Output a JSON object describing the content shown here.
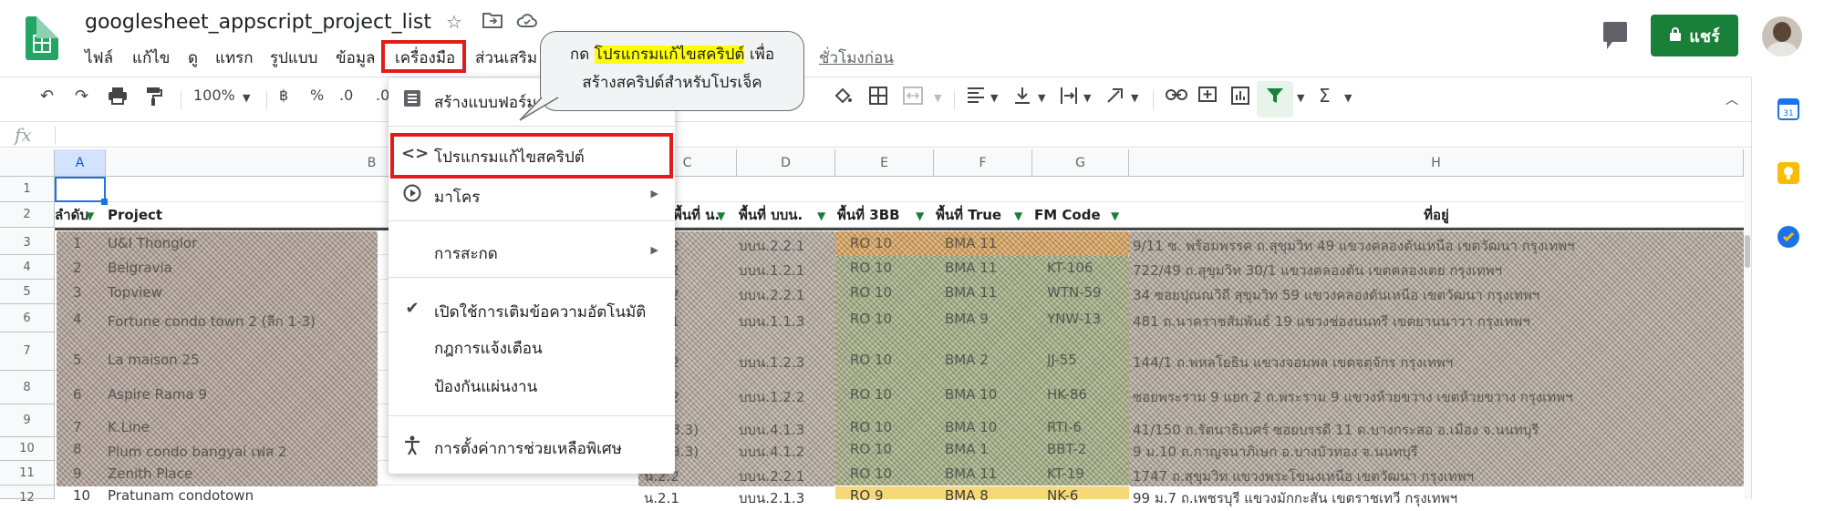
{
  "header": {
    "doc_title": "googlesheet_appscript_project_list",
    "last_edit": "ชั่วโมงก่อน",
    "share_label": "แชร์"
  },
  "menubar": {
    "items": [
      "ไฟล์",
      "แก้ไข",
      "ดู",
      "แทรก",
      "รูปแบบ",
      "ข้อมูล",
      "เครื่องมือ",
      "ส่วนเสริม"
    ]
  },
  "toolbar": {
    "zoom": "100%",
    "baht": "฿",
    "percent": "%",
    "decimal_less": ".0",
    "decimal_more": ".00"
  },
  "tools_menu": {
    "items": [
      {
        "label": "สร้างแบบฟอร์ม",
        "icon": "form-icon"
      },
      {
        "label": "โปรแกรมแก้ไขสคริปต์",
        "icon": "code-icon"
      },
      {
        "label": "มาโคร",
        "icon": "play-icon"
      },
      {
        "label": "การสะกด",
        "icon": ""
      },
      {
        "label": "เปิดใช้การเติมข้อความอัตโนมัติ",
        "icon": "check-icon"
      },
      {
        "label": "กฎการแจ้งเตือน",
        "icon": ""
      },
      {
        "label": "ป้องกันแผ่นงาน",
        "icon": ""
      },
      {
        "label": "การตั้งค่าการช่วยเหลือพิเศษ",
        "icon": "accessibility-icon"
      }
    ]
  },
  "tooltip": {
    "prefix": "กด",
    "highlight": "โปรแกรมแก้ไขสคริปต์",
    "suffix": "เพื่อ",
    "line2": "สร้างสคริปต์สำหรับโปรเจ็ค"
  },
  "grid": {
    "col_headers": [
      "A",
      "B",
      "C",
      "D",
      "E",
      "F",
      "G",
      "H"
    ],
    "row_numbers": [
      "1",
      "2",
      "3",
      "4",
      "5",
      "6",
      "7",
      "8",
      "9",
      "10",
      "11",
      "12"
    ],
    "header_row": {
      "a": "ลำดับ",
      "b": "Project",
      "c": "พื้นที่ น.",
      "d": "พื้นที่ บบน.",
      "e": "พื้นที่ 3BB",
      "f": "พื้นที่ True",
      "g": "FM Code",
      "h": "ที่อยู่"
    },
    "rows": [
      {
        "a": "1",
        "b": "U&I Thonglor",
        "c": "น.2.2",
        "d": "บบน.2.2.1",
        "e": "RO 10",
        "f": "BMA 11",
        "g": "",
        "h": "9/11 ซ. พร้อมพรรค ถ.สุขุมวิท 49 แขวงคลองตันเหนือ เขตวัฒนา กรุงเทพฯ"
      },
      {
        "a": "2",
        "b": "Belgravia",
        "c": "น.1.2",
        "d": "บบน.1.2.1",
        "e": "RO 10",
        "f": "BMA 11",
        "g": "KT-106",
        "h": "722/49 ถ.สุขุมวิท 30/1 แขวงคลองตัน เขตคลองเตย กรุงเทพฯ"
      },
      {
        "a": "3",
        "b": "Topview",
        "c": "น.2.2",
        "d": "บบน.2.2.1",
        "e": "RO 10",
        "f": "BMA 11",
        "g": "WTN-59",
        "h": "34 ซอยปุณณวิถี สุขุมวิท 59 แขวงคลองตันเหนือ เขตวัฒนา กรุงเทพฯ"
      },
      {
        "a": "4",
        "b": "Fortune condo town 2 (ลีก 1-3)",
        "c": "น.1.1",
        "d": "บบน.1.1.3",
        "e": "RO 10",
        "f": "BMA 9",
        "g": "YNW-13",
        "h": "481 ถ.นาคราชสัมพันธ์ 19 แขวงช่องนนทรี เขตยานนาวา กรุงเทพฯ"
      },
      {
        "a": "5",
        "b": "La maison 25",
        "c": "น.1.2",
        "d": "บบน.1.2.3",
        "e": "RO 10",
        "f": "BMA 2",
        "g": "JJ-55",
        "h": "144/1 ถ.พหลโยธิน แขวงจอมพล เขตจตุจักร กรุงเทพฯ"
      },
      {
        "a": "6",
        "b": "Aspire Rama 9",
        "c": "น.1.2",
        "d": "บบน.1.2.2",
        "e": "RO 10",
        "f": "BMA 10",
        "g": "HK-86",
        "h": "ซอยพระราม 9 แยก 2 ถ.พระราม 9 แขวงห้วยขวาง เขตห้วยขวาง กรุงเทพฯ"
      },
      {
        "a": "7",
        "b": "K.Line",
        "c": "น.1(3.3)",
        "d": "บบน.4.1.3",
        "e": "RO 10",
        "f": "BMA 10",
        "g": "RTI-6",
        "h": "41/150 ถ.รัตนาธิเบศร์ ซอยบรรดี 11 ต.บางกระสอ อ.เมือง จ.นนทบุรี"
      },
      {
        "a": "8",
        "b": "Plum condo bangyai เฟส 2",
        "c": "น.1(3.3)",
        "d": "บบน.4.1.2",
        "e": "RO 10",
        "f": "BMA 1",
        "g": "BBT-2",
        "h": "9 ม.10 ถ.กาญจนาภิเษก อ.บางบัวทอง จ.นนทบุรี"
      },
      {
        "a": "9",
        "b": "Zenith Place",
        "c": "น.2.2",
        "d": "บบน.2.2.1",
        "e": "RO 10",
        "f": "BMA 11",
        "g": "KT-19",
        "h": "1747 ถ.สุขุมวิท แขวงพระโขนงเหนือ เขตวัฒนา กรุงเทพฯ"
      },
      {
        "a": "10",
        "b": "Pratunam condotown",
        "c": "น.2.1",
        "d": "บบน.2.1.3",
        "e": "RO 9",
        "f": "BMA 8",
        "g": "NK-6",
        "h": "99 ม.7 ถ.เพชรบุรี แขวงมักกะสัน เขตราชเทวี กรุงเทพฯ"
      }
    ]
  },
  "colors": {
    "accent_red": "#e31b1b",
    "share_green": "#188038",
    "sheets_green": "#23a566",
    "tooltip_highlight": "#ffff00",
    "orange_row": "#e3a04a",
    "green_cell": "#9bb37a"
  }
}
